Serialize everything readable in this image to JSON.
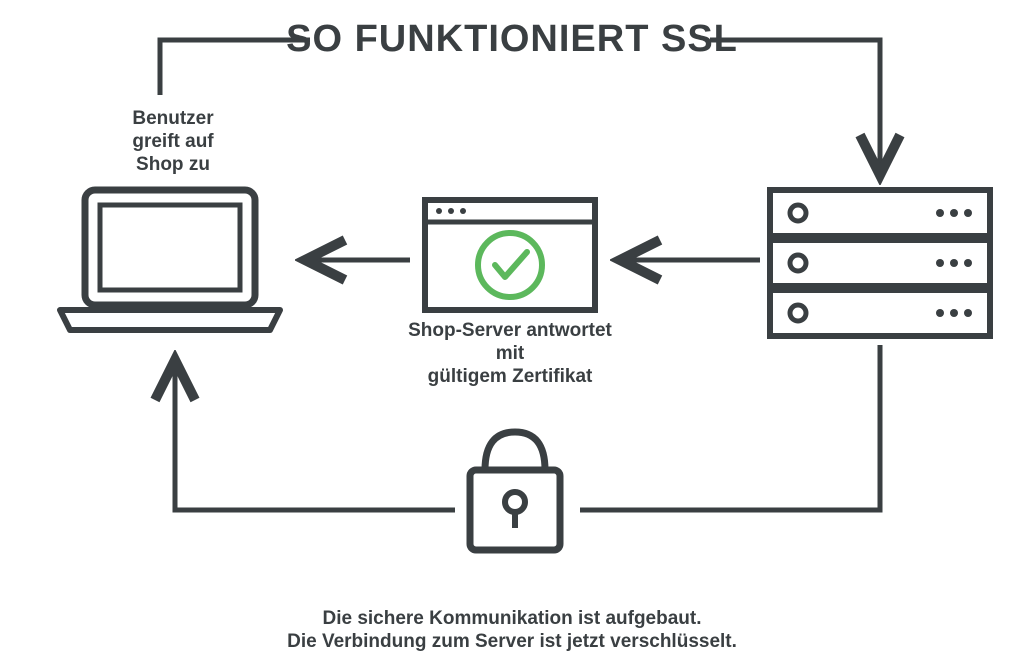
{
  "title": "SO FUNKTIONIERT SSL",
  "labels": {
    "user": "Benutzer\ngreift auf\nShop zu",
    "certificate": "Shop-Server antwortet mit\ngültigem Zertifikat",
    "secure1": "Die sichere Kommunikation ist aufgebaut.",
    "secure2": "Die Verbindung zum Server ist jetzt verschlüsselt."
  },
  "colors": {
    "stroke": "#3a3f42",
    "accent": "#5cb85c"
  }
}
